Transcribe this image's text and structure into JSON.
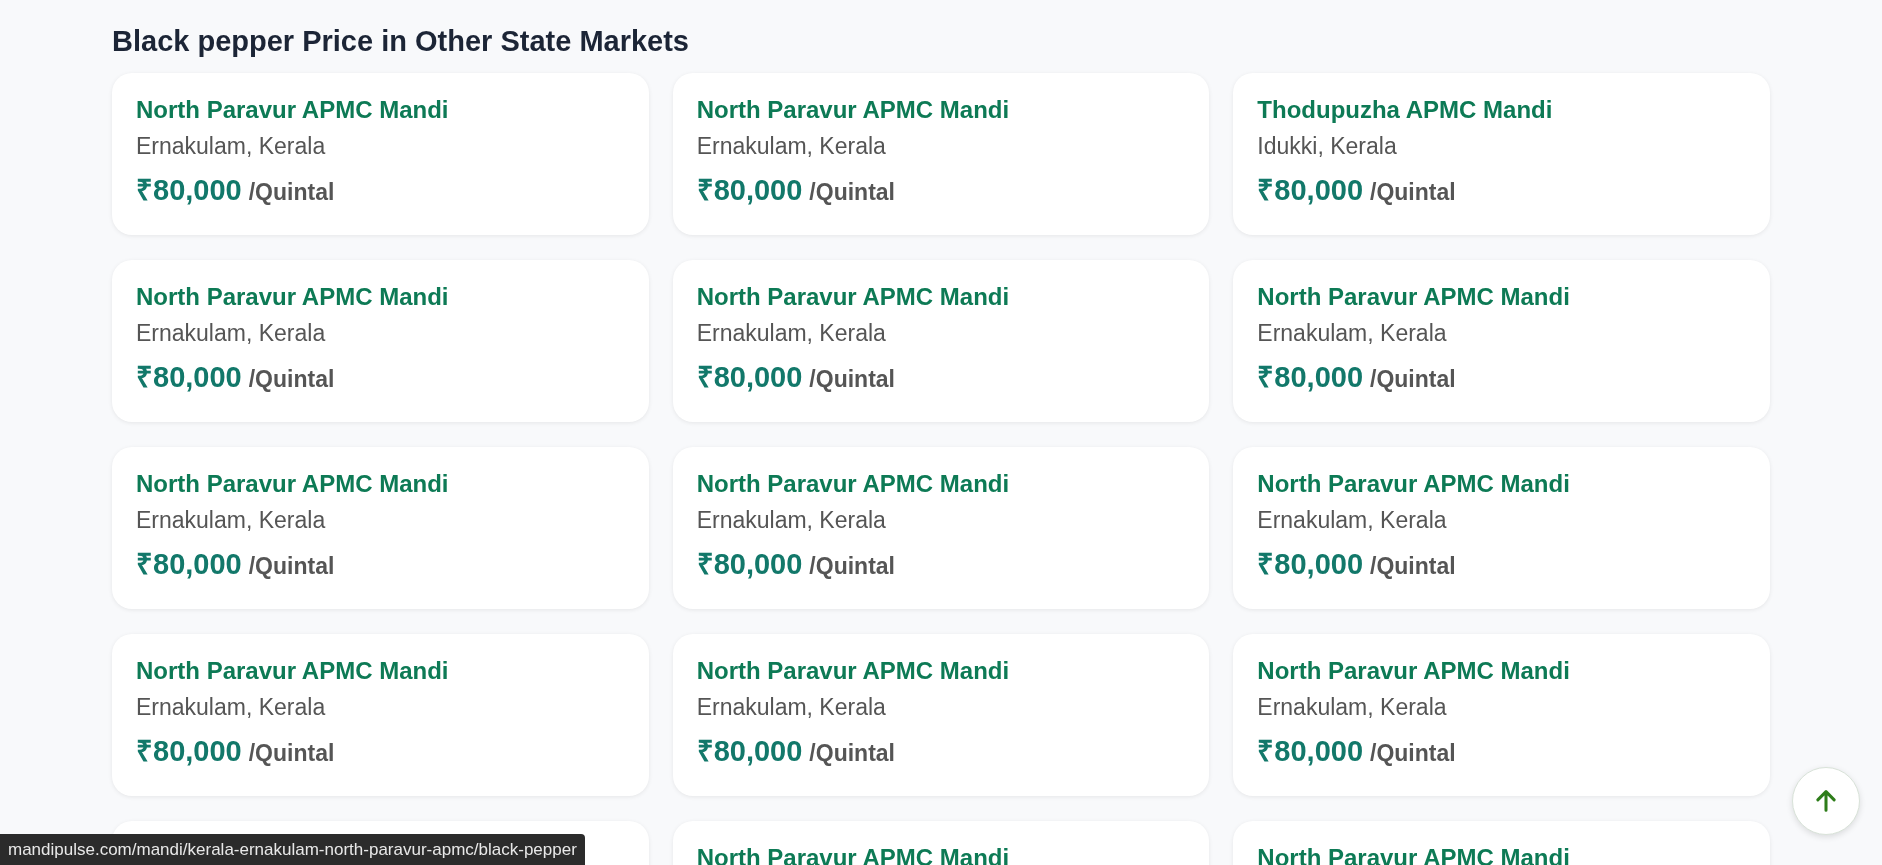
{
  "heading": "Black pepper Price in Other State Markets",
  "markets": [
    {
      "name": "North Paravur APMC Mandi",
      "location": "Ernakulam, Kerala",
      "price": "₹80,000",
      "unit": "/Quintal"
    },
    {
      "name": "North Paravur APMC Mandi",
      "location": "Ernakulam, Kerala",
      "price": "₹80,000",
      "unit": "/Quintal"
    },
    {
      "name": "Thodupuzha APMC Mandi",
      "location": "Idukki, Kerala",
      "price": "₹80,000",
      "unit": "/Quintal"
    },
    {
      "name": "North Paravur APMC Mandi",
      "location": "Ernakulam, Kerala",
      "price": "₹80,000",
      "unit": "/Quintal"
    },
    {
      "name": "North Paravur APMC Mandi",
      "location": "Ernakulam, Kerala",
      "price": "₹80,000",
      "unit": "/Quintal"
    },
    {
      "name": "North Paravur APMC Mandi",
      "location": "Ernakulam, Kerala",
      "price": "₹80,000",
      "unit": "/Quintal"
    },
    {
      "name": "North Paravur APMC Mandi",
      "location": "Ernakulam, Kerala",
      "price": "₹80,000",
      "unit": "/Quintal"
    },
    {
      "name": "North Paravur APMC Mandi",
      "location": "Ernakulam, Kerala",
      "price": "₹80,000",
      "unit": "/Quintal"
    },
    {
      "name": "North Paravur APMC Mandi",
      "location": "Ernakulam, Kerala",
      "price": "₹80,000",
      "unit": "/Quintal"
    },
    {
      "name": "North Paravur APMC Mandi",
      "location": "Ernakulam, Kerala",
      "price": "₹80,000",
      "unit": "/Quintal"
    },
    {
      "name": "North Paravur APMC Mandi",
      "location": "Ernakulam, Kerala",
      "price": "₹80,000",
      "unit": "/Quintal"
    },
    {
      "name": "North Paravur APMC Mandi",
      "location": "Ernakulam, Kerala",
      "price": "₹80,000",
      "unit": "/Quintal"
    },
    {
      "name": "North Paravur APMC Mandi"
    },
    {
      "name": "North Paravur APMC Mandi"
    }
  ],
  "status_url": "mandipulse.com/mandi/kerala-ernakulam-north-paravur-apmc/black-pepper"
}
